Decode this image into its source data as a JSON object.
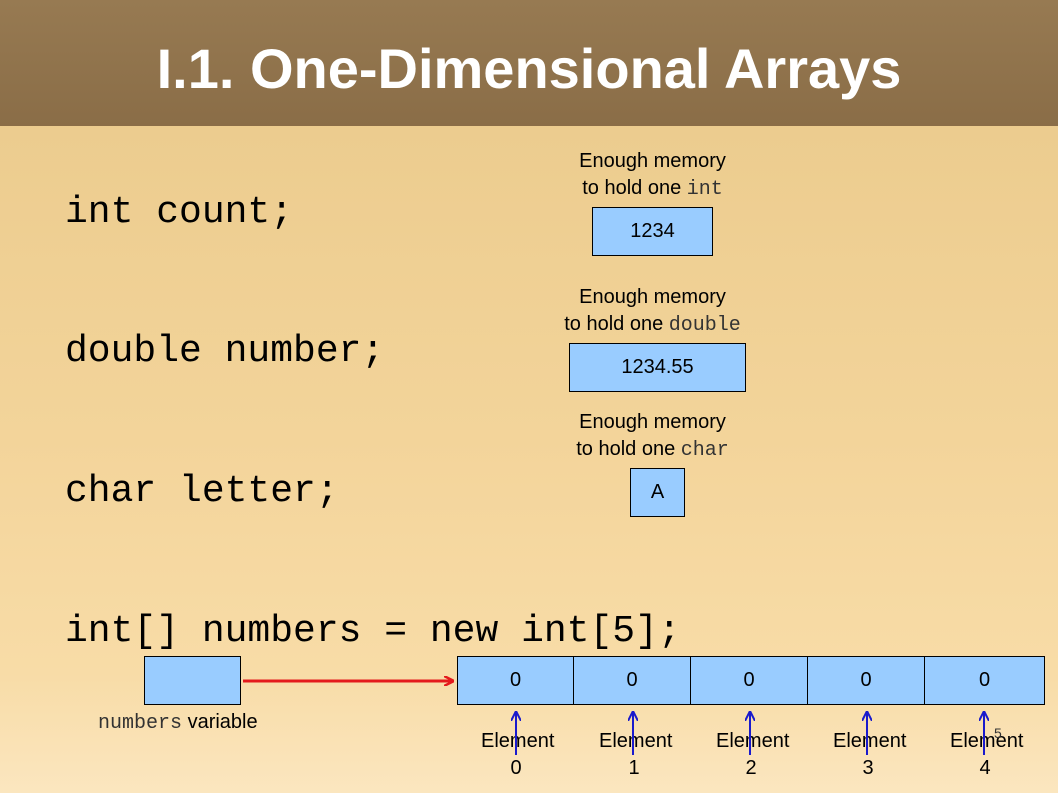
{
  "title": "I.1. One-Dimensional Arrays",
  "code_lines": {
    "line1": "int count;",
    "line2": "double number;",
    "line3": "char letter;",
    "line4": "int[] numbers = new int[5];"
  },
  "int_block": {
    "caption_prefix": "Enough memory",
    "caption_line2": "to hold one ",
    "type": "int",
    "value": "1234"
  },
  "double_block": {
    "caption_prefix": "Enough memory",
    "caption_line2": "to hold one ",
    "type": "double",
    "value": "1234.55"
  },
  "char_block": {
    "caption_prefix": "Enough memory",
    "caption_line2": "to hold one ",
    "type": "char",
    "value": "A"
  },
  "array": {
    "variable_name": "numbers",
    "variable_suffix": " variable",
    "elements": [
      "0",
      "0",
      "0",
      "0",
      "0"
    ],
    "element_labels": [
      "Element 0",
      "Element 1",
      "Element 2",
      "Element 3",
      "Element 4"
    ]
  },
  "page_number": "5",
  "colors": {
    "box_fill": "#99ccff",
    "pointer_arrow": "#e41a1c",
    "index_arrow": "#1a1acc"
  }
}
